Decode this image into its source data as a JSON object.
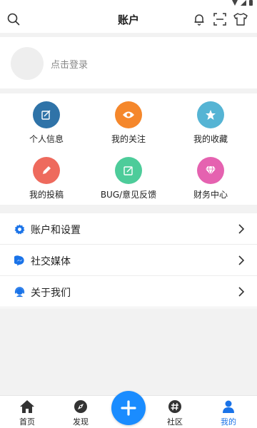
{
  "header": {
    "title": "账户"
  },
  "login": {
    "prompt": "点击登录"
  },
  "grid": [
    {
      "label": "个人信息",
      "color": "#2f73a8",
      "icon": "edit-icon"
    },
    {
      "label": "我的关注",
      "color": "#f5872b",
      "icon": "eye-icon"
    },
    {
      "label": "我的收藏",
      "color": "#55b4d4",
      "icon": "star-icon"
    },
    {
      "label": "我的投稿",
      "color": "#ee6a5d",
      "icon": "pencil-icon"
    },
    {
      "label": "BUG/意见反馈",
      "color": "#4dcc9a",
      "icon": "feedback-icon"
    },
    {
      "label": "财务中心",
      "color": "#e562b0",
      "icon": "diamond-icon"
    }
  ],
  "menu": [
    {
      "label": "账户和设置",
      "icon": "gear-icon"
    },
    {
      "label": "社交媒体",
      "icon": "messenger-icon"
    },
    {
      "label": "关于我们",
      "icon": "support-icon"
    }
  ],
  "tabbar": {
    "home": "首页",
    "discover": "发现",
    "community": "社区",
    "mine": "我的",
    "active": "mine",
    "accent": "#1a73e8"
  }
}
